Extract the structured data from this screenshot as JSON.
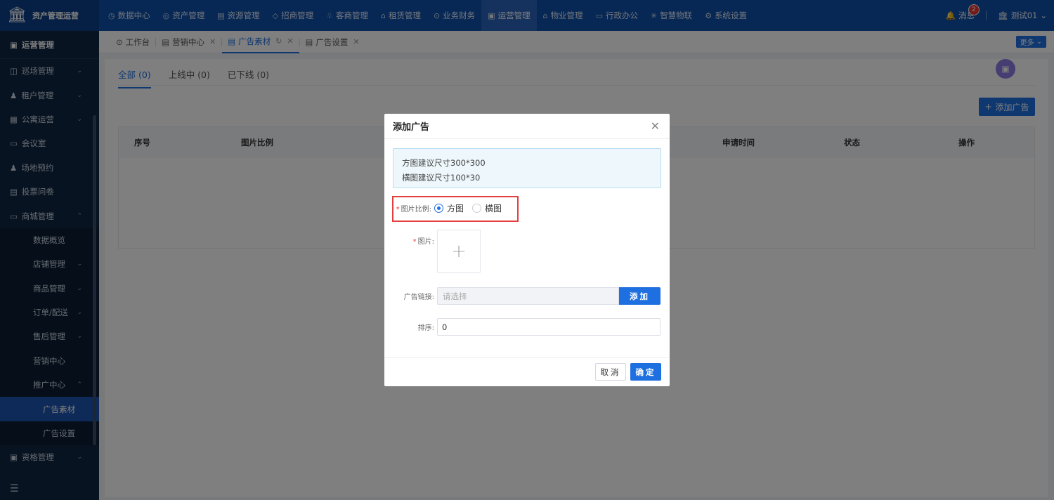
{
  "app": {
    "title": "资产管理运营"
  },
  "nav": [
    {
      "icon": "◷",
      "label": "数据中心"
    },
    {
      "icon": "◎",
      "label": "资产管理"
    },
    {
      "icon": "▤",
      "label": "资源管理"
    },
    {
      "icon": "◇",
      "label": "招商管理"
    },
    {
      "icon": "♧",
      "label": "客商管理"
    },
    {
      "icon": "⌂",
      "label": "租赁管理"
    },
    {
      "icon": "⊙",
      "label": "业务财务"
    },
    {
      "icon": "▣",
      "label": "运营管理"
    },
    {
      "icon": "⌂",
      "label": "物业管理"
    },
    {
      "icon": "▭",
      "label": "行政办公"
    },
    {
      "icon": "✳",
      "label": "智慧物联"
    },
    {
      "icon": "⚙",
      "label": "系统设置"
    }
  ],
  "header_right": {
    "messages_label": "消息",
    "messages_count": "2",
    "user": "测试01"
  },
  "sidebar": {
    "title": "运营管理",
    "items": [
      {
        "label": "巡场管理",
        "icon": "◫",
        "chevron": "⌄"
      },
      {
        "label": "租户管理",
        "icon": "♟",
        "chevron": "⌄"
      },
      {
        "label": "公寓运营",
        "icon": "▦",
        "chevron": "⌄"
      },
      {
        "label": "会议室",
        "icon": "▭",
        "chevron": ""
      },
      {
        "label": "场地预约",
        "icon": "♟",
        "chevron": ""
      },
      {
        "label": "投票问卷",
        "icon": "▤",
        "chevron": ""
      },
      {
        "label": "商城管理",
        "icon": "▭",
        "chevron": "⌃"
      }
    ],
    "mall_sub": [
      {
        "label": "数据概览",
        "chevron": ""
      },
      {
        "label": "店铺管理",
        "chevron": "⌄"
      },
      {
        "label": "商品管理",
        "chevron": "⌄"
      },
      {
        "label": "订单/配送",
        "chevron": "⌄"
      },
      {
        "label": "售后管理",
        "chevron": "⌄"
      },
      {
        "label": "营销中心",
        "chevron": ""
      },
      {
        "label": "推广中心",
        "chevron": "⌃"
      }
    ],
    "promo_sub": [
      {
        "label": "广告素材"
      },
      {
        "label": "广告设置"
      }
    ],
    "last_item": {
      "label": "资格管理",
      "icon": "▣",
      "chevron": "⌄"
    }
  },
  "tabs": [
    {
      "icon": "⊙",
      "label": "工作台"
    },
    {
      "icon": "▤",
      "label": "营销中心"
    },
    {
      "icon": "▤",
      "label": "广告素材"
    },
    {
      "icon": "▤",
      "label": "广告设置"
    }
  ],
  "more_label": "更多",
  "filter_tabs": [
    "全部 (0)",
    "上线中 (0)",
    "已下线 (0)"
  ],
  "add_ad_button": "添加广告",
  "table_headers": [
    "序号",
    "图片比例",
    "申请时间",
    "状态",
    "操作"
  ],
  "modal": {
    "title": "添加广告",
    "tips": [
      "方图建议尺寸300*300",
      "横图建议尺寸100*30"
    ],
    "ratio_label": "图片比例:",
    "ratio_options": [
      "方图",
      "横图"
    ],
    "image_label": "图片:",
    "link_label": "广告链接:",
    "link_placeholder": "请选择",
    "link_add_button": "添加",
    "sort_label": "排序:",
    "sort_value": "0",
    "cancel": "取消",
    "confirm": "确定"
  }
}
